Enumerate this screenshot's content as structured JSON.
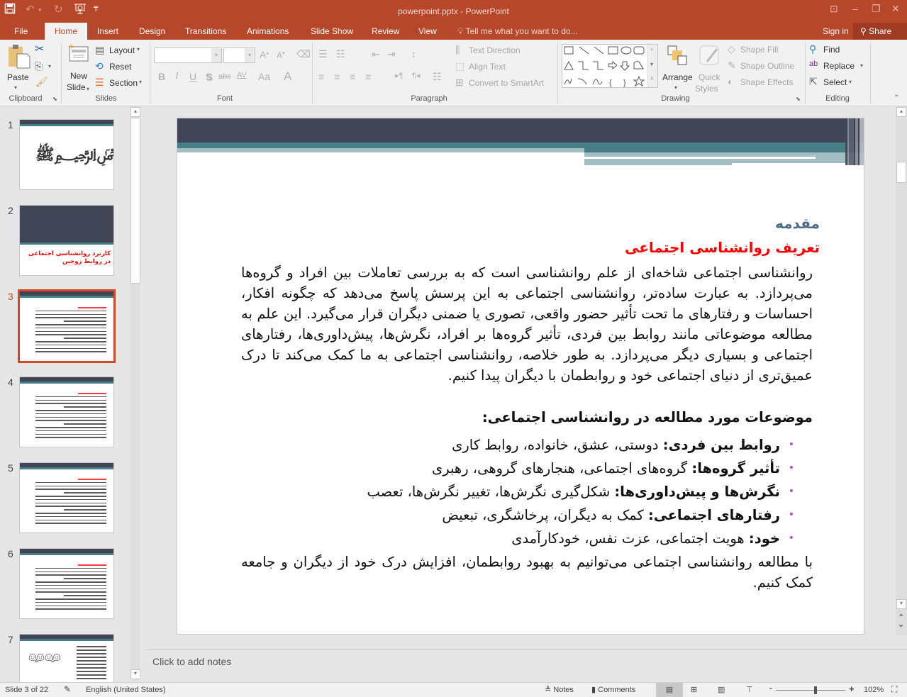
{
  "window": {
    "title": "powerpoint.pptx - PowerPoint",
    "qat": [
      "save-icon",
      "undo-icon",
      "redo-icon",
      "start-from-beginning-icon",
      "customize-qat-icon"
    ],
    "controls": [
      "ribbon-display-options",
      "minimize",
      "restore",
      "close"
    ]
  },
  "tabs": [
    {
      "label": "File"
    },
    {
      "label": "Home",
      "active": true
    },
    {
      "label": "Insert"
    },
    {
      "label": "Design"
    },
    {
      "label": "Transitions"
    },
    {
      "label": "Animations"
    },
    {
      "label": "Slide Show"
    },
    {
      "label": "Review"
    },
    {
      "label": "View"
    }
  ],
  "tellme": "Tell me what you want to do...",
  "signin": "Sign in",
  "share": "Share",
  "ribbon": {
    "clipboard": {
      "paste": "Paste",
      "label": "Clipboard"
    },
    "slides": {
      "new_slide_1": "New",
      "new_slide_2": "Slide",
      "layout": "Layout",
      "reset": "Reset",
      "section": "Section",
      "label": "Slides"
    },
    "font": {
      "font_name": "",
      "font_size": "",
      "bold": "B",
      "italic": "I",
      "underline": "U",
      "shadow": "S",
      "strike": "abc",
      "spacing": "AV",
      "case": "Aa",
      "color": "A",
      "label": "Font"
    },
    "paragraph": {
      "text_direction": "Text Direction",
      "align_text": "Align Text",
      "smartart": "Convert to SmartArt",
      "label": "Paragraph"
    },
    "drawing": {
      "arrange": "Arrange",
      "quick_1": "Quick",
      "quick_2": "Styles",
      "shape_fill": "Shape Fill",
      "shape_outline": "Shape Outline",
      "shape_effects": "Shape Effects",
      "label": "Drawing"
    },
    "editing": {
      "find": "Find",
      "replace": "Replace",
      "select": "Select",
      "label": "Editing"
    }
  },
  "thumbnails": [
    {
      "num": "1",
      "kind": "calligraphy"
    },
    {
      "num": "2",
      "kind": "title",
      "title": "کاربرد روانشناسی اجتماعی در روابط زوجین"
    },
    {
      "num": "3",
      "kind": "text",
      "selected": true
    },
    {
      "num": "4",
      "kind": "text"
    },
    {
      "num": "5",
      "kind": "text"
    },
    {
      "num": "6",
      "kind": "text"
    },
    {
      "num": "7",
      "kind": "image-text"
    }
  ],
  "slide": {
    "heading": "مقدمه",
    "subheading": "تعریف روانشناسی اجتماعی",
    "paragraph": "روانشناسی اجتماعی شاخه‌ای از علم روانشناسی است که به بررسی تعاملات بین افراد و گروه‌ها می‌پردازد. به عبارت ساده‌تر، روانشناسی اجتماعی به این پرسش پاسخ می‌دهد که چگونه افکار، احساسات و رفتارهای ما تحت تأثیر حضور واقعی، تصوری یا ضمنی دیگران قرار می‌گیرد. این علم به مطالعه موضوعاتی مانند روابط بین فردی، تأثیر گروه‌ها بر افراد، نگرش‌ها، پیش‌داوری‌ها، رفتارهای اجتماعی و بسیاری دیگر می‌پردازد. به طور خلاصه، روانشناسی اجتماعی به ما کمک می‌کند تا درک عمیق‌تری از دنیای اجتماعی خود و روابطمان با دیگران پیدا کنیم.",
    "topics_heading": "موضوعات مورد مطالعه در روانشناسی اجتماعی:",
    "bullets": [
      {
        "term": "روابط بین فردی:",
        "text": " دوستی، عشق، خانواده، روابط کاری"
      },
      {
        "term": "تأثیر گروه‌ها:",
        "text": " گروه‌های اجتماعی، هنجارهای گروهی، رهبری"
      },
      {
        "term": "نگرش‌ها و پیش‌داوری‌ها:",
        "text": " شکل‌گیری نگرش‌ها، تغییر نگرش‌ها، تعصب"
      },
      {
        "term": "رفتارهای اجتماعی:",
        "text": " کمک به دیگران، پرخاشگری، تبعیض"
      },
      {
        "term": "خود:",
        "text": " هویت اجتماعی، عزت نفس، خودکارآمدی"
      }
    ],
    "conclusion": "با مطالعه روانشناسی اجتماعی می‌توانیم به بهبود روابطمان، افزایش درک خود از دیگران و جامعه کمک کنیم.",
    "colors": {
      "heading": "#4a6b85",
      "subheading": "#ff0000",
      "bullet": "#a05ab4",
      "band_dark": "#404455",
      "band_teal": "#457e86",
      "band_light": "#a2bec2"
    }
  },
  "notes_placeholder": "Click to add notes",
  "status": {
    "slide_info": "Slide 3 of 22",
    "language": "English (United States)",
    "notes": "Notes",
    "comments": "Comments",
    "zoom": "102%",
    "zoom_slider": 0.57
  }
}
